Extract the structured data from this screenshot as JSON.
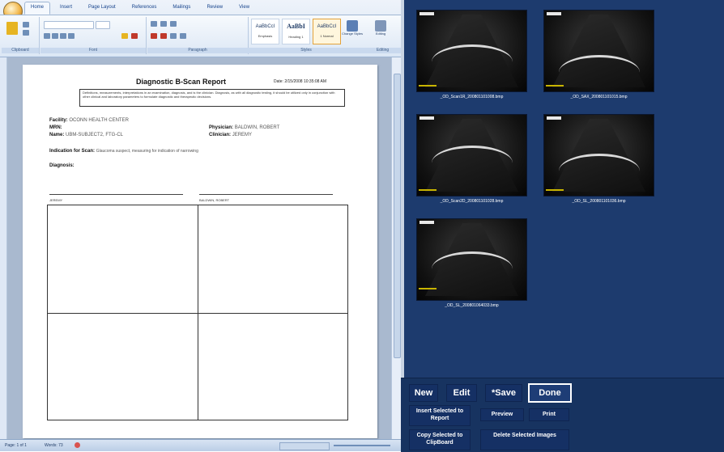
{
  "word": {
    "tabs": [
      "Home",
      "Insert",
      "Page Layout",
      "References",
      "Mailings",
      "Review",
      "View"
    ],
    "ribbon_groups": [
      "Clipboard",
      "Font",
      "Paragraph",
      "Styles",
      "Editing"
    ],
    "styles": [
      {
        "sample": "AaBbCcI",
        "name": "Emphasis"
      },
      {
        "sample": "AaBbI",
        "name": "Heading 1"
      },
      {
        "sample": "AaBbCcI",
        "name": "1 Normal"
      }
    ],
    "change_styles": "Change Styles",
    "editing": "Editing",
    "document": {
      "title": "Diagnostic B-Scan Report",
      "date": "Date: 2/15/2008  10:35:08  AM",
      "disclaimer": "Definitions, measurements, interpretations in an examination, diagnosis, and is the clinician. Diagnosis, as with all diagnostic testing, it should be utilized only in conjunction with other clinical and laboratory parameters to formulate diagnostic and therapeutic decisions.",
      "facility_label": "Facility:",
      "facility_value": "OCONN HEALTH CENTER",
      "mrn_label": "MRN:",
      "name_label": "Name:",
      "name_value": "UBM-SUBJECT2, FTG-CL",
      "physician_label": "Physician:",
      "physician_value": "BALDWIN, ROBERT",
      "clinician_label": "Clinician:",
      "clinician_value": "JEREMY",
      "indication_label": "Indication for Scan:",
      "indication_value": "Glaucoma suspect, measuring for indication of narrowing",
      "diagnosis_label": "Diagnosis:",
      "sig_left": "JEREMY",
      "sig_right": "BALDWIN, ROBERT"
    },
    "status": {
      "page": "Page: 1 of 1",
      "words": "Words: 73"
    }
  },
  "viewer": {
    "images": [
      {
        "filename": "_OD_Scan1R_200801101008.bmp"
      },
      {
        "filename": "_OD_SAX_200801101015.bmp"
      },
      {
        "filename": "_OD_Scan2D_200801101028.bmp"
      },
      {
        "filename": "_OD_SL_200801101036.bmp"
      },
      {
        "filename": "_OD_SL_200801064033.bmp"
      }
    ],
    "buttons": {
      "new": "New",
      "edit": "Edit",
      "save": "*Save",
      "done": "Done",
      "insert": "Insert Selected to Report",
      "preview": "Preview",
      "print": "Print",
      "copy": "Copy Selected to ClipBoard",
      "delete": "Delete Selected Images"
    },
    "colors": {
      "background": "#1d3b6e",
      "button": "#153064",
      "text": "#ffffff"
    }
  }
}
